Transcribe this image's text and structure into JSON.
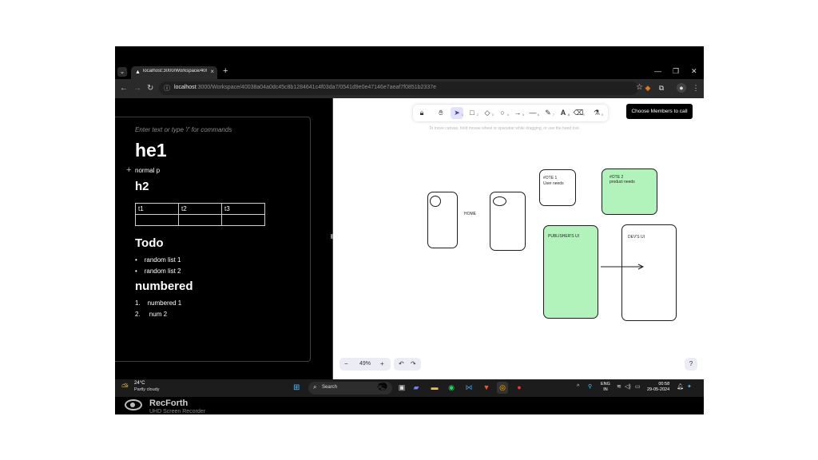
{
  "browser": {
    "tab_title": "localhost:3000/Workspace/4003",
    "tab_close": "×",
    "new_tab": "+",
    "tab_menu": "⌄",
    "url_host": "localhost",
    "url_rest": ":3000/Workspace/40038a04a0dc45c8b1284641c4f03da7/0541d9e0e47146e7aeaf7f0851b2337e"
  },
  "editor": {
    "placeholder": "Enter text or type '/' for commands",
    "h1": "he1",
    "paragraph": "normal p",
    "h2": "h2",
    "table": [
      [
        "t1",
        "t2",
        "t3"
      ],
      [
        "",
        "",
        ""
      ]
    ],
    "todo_heading": "Todo",
    "todo_items": [
      "random list 1",
      "random list 2"
    ],
    "numbered_heading": "numbered",
    "numbered_items": [
      {
        "marker": "1.",
        "text": "numbered 1"
      },
      {
        "marker": "2.",
        "text": "num 2"
      }
    ]
  },
  "canvas": {
    "choose_button": "Choose Members to call",
    "hint": "To move canvas, hold mouse wheel or spacebar while dragging, or use the hand tool",
    "note1_line1": "#OTE 1",
    "note1_line2": "User needs",
    "note2_line1": "#OTE 2",
    "note2_line2": "product needs",
    "home_label": "HOME",
    "publisher_label": "PUBLISHER'S UI",
    "devs_label": "DEV'S UI",
    "zoom_level": "49%",
    "zoom_out": "−",
    "zoom_in": "+",
    "green": "#b2f2bb",
    "tool_numbers": [
      "1",
      "2",
      "3",
      "4",
      "5",
      "6",
      "7",
      "8",
      "9",
      "0"
    ]
  },
  "taskbar": {
    "temperature": "24°C",
    "condition": "Partly cloudy",
    "search": "Search",
    "lang_line1": "ENG",
    "lang_line2": "IN",
    "time": "00:58",
    "date": "29-05-2024"
  },
  "recorder": {
    "name": "RecForth",
    "subtitle": "UHD Screen Recorder"
  }
}
